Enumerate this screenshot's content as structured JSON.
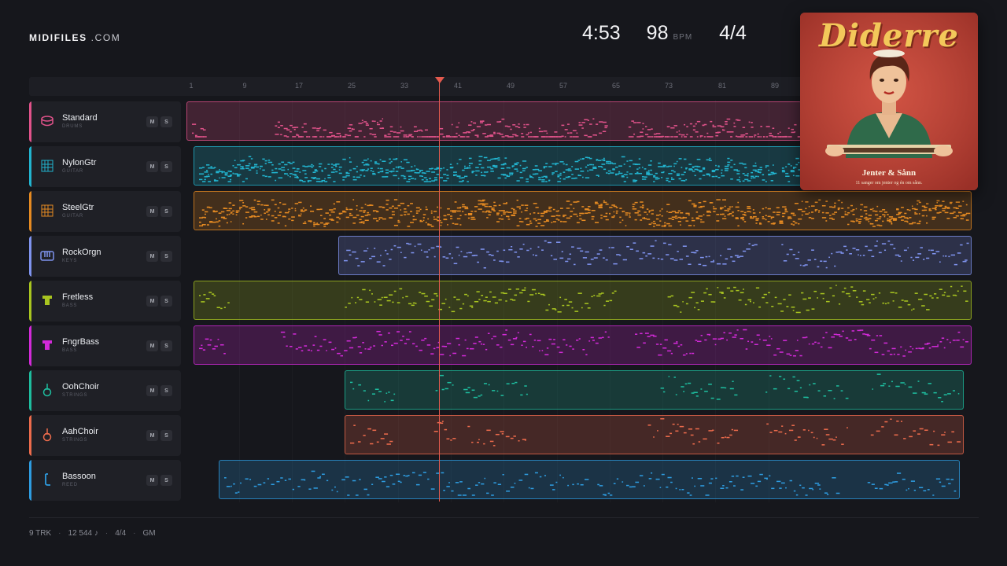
{
  "brand": {
    "name": "MIDIFILES",
    "suffix": ".COM"
  },
  "stats": {
    "time": "4:53",
    "tempo": "98",
    "tempo_unit": "BPM",
    "meter": "4/4"
  },
  "ruler": {
    "ticks": [
      "1",
      "9",
      "17",
      "25",
      "33",
      "41",
      "49",
      "57",
      "65",
      "73",
      "81",
      "89"
    ]
  },
  "tracks": [
    {
      "name": "Standard",
      "category": "DRUMS",
      "color": "#e0528a",
      "icon": "drum-icon",
      "mute": "M",
      "solo": "S"
    },
    {
      "name": "NylonGtr",
      "category": "GUITAR",
      "color": "#22b4cf",
      "icon": "guitar-icon",
      "mute": "M",
      "solo": "S"
    },
    {
      "name": "SteelGtr",
      "category": "GUITAR",
      "color": "#e58a22",
      "icon": "guitar-icon",
      "mute": "M",
      "solo": "S"
    },
    {
      "name": "RockOrgn",
      "category": "KEYS",
      "color": "#7f93ee",
      "icon": "keys-icon",
      "mute": "M",
      "solo": "S"
    },
    {
      "name": "Fretless",
      "category": "BASS",
      "color": "#a8c420",
      "icon": "bass-icon",
      "mute": "M",
      "solo": "S"
    },
    {
      "name": "FngrBass",
      "category": "BASS",
      "color": "#d22ad8",
      "icon": "bass-icon",
      "mute": "M",
      "solo": "S"
    },
    {
      "name": "OohChoir",
      "category": "STRINGS",
      "color": "#1ebc9e",
      "icon": "violin-icon",
      "mute": "M",
      "solo": "S"
    },
    {
      "name": "AahChoir",
      "category": "STRINGS",
      "color": "#ec6b4c",
      "icon": "violin-icon",
      "mute": "M",
      "solo": "S"
    },
    {
      "name": "Bassoon",
      "category": "REED",
      "color": "#2e9ce0",
      "icon": "bassoon-icon",
      "mute": "M",
      "solo": "S"
    }
  ],
  "playhead_bar": 38,
  "album": {
    "title": "Diderre",
    "subtitle": "Jenter & Sånn",
    "tagline": "11 sanger om jenter og én om sånn."
  },
  "footer": {
    "tracks": "9 TRK",
    "notes": "12 544 ♪",
    "meter": "4/4",
    "standard": "GM"
  }
}
